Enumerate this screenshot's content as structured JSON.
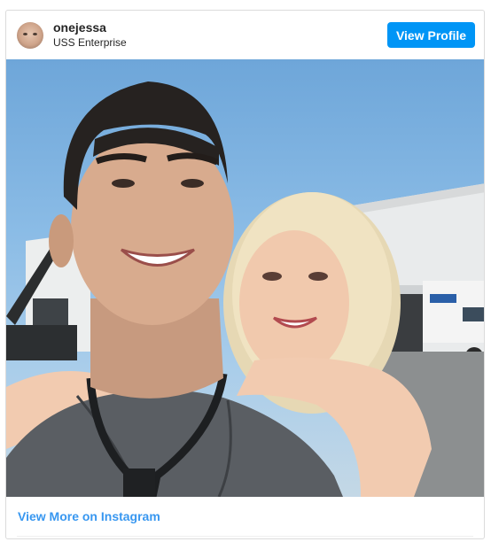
{
  "header": {
    "username": "onejessa",
    "location": "USS Enterprise",
    "view_profile_label": "View Profile"
  },
  "post": {
    "image_alt": "Selfie of two smiling people on a studio lot"
  },
  "footer": {
    "view_more_label": "View More on Instagram"
  },
  "colors": {
    "accent": "#0095f6",
    "link": "#3897f0",
    "border": "#dbdbdb"
  }
}
